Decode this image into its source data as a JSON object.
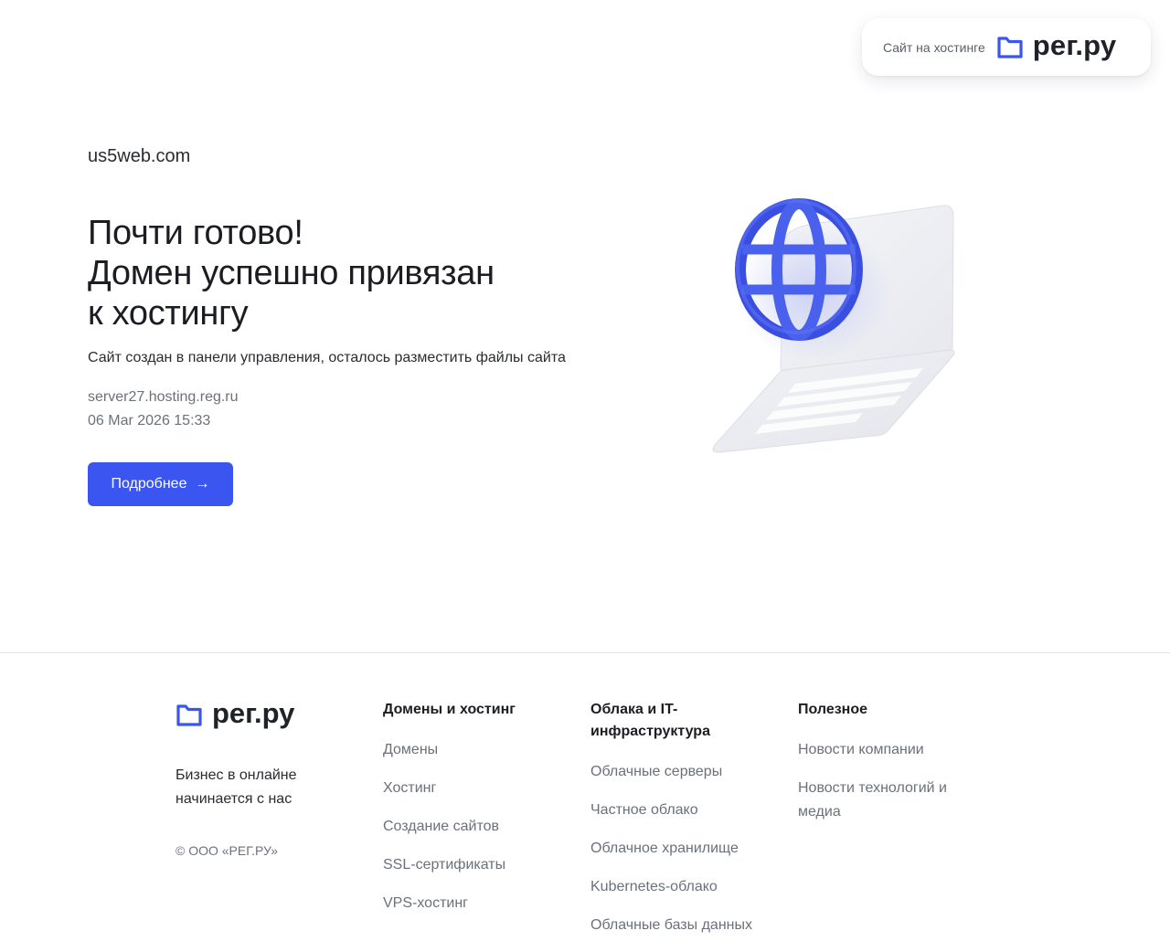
{
  "badge": {
    "label": "Сайт на хостинге",
    "logo_text": "рег.ру"
  },
  "main": {
    "domain": "us5web.com",
    "headline_lines": [
      "Почти готово!",
      "Домен успешно привязан",
      "к хостингу"
    ],
    "subtitle": "Сайт создан в панели управления, осталось разместить файлы сайта",
    "server": "server27.hosting.reg.ru",
    "datetime": "06 Mar 2026 15:33",
    "button_label": "Подробнее"
  },
  "footer": {
    "logo_text": "рег.ру",
    "tagline_lines": [
      "Бизнес в онлайне",
      "начинается с нас"
    ],
    "copyright": "© ООО «РЕГ.РУ»",
    "columns": [
      {
        "title": "Домены и хостинг",
        "items": [
          "Домены",
          "Хостинг",
          "Создание сайтов",
          "SSL-сертификаты",
          "VPS-хостинг"
        ]
      },
      {
        "title": "Облака и IT-инфраструктура",
        "items": [
          "Облачные серверы",
          "Частное облако",
          "Облачное хранилище",
          "Kubernetes-облако",
          "Облачные базы данных"
        ]
      },
      {
        "title": "Полезное",
        "items": [
          "Новости компании",
          "Новости технологий и медиа"
        ]
      }
    ]
  },
  "colors": {
    "accent": "#3a55f0",
    "text": "#1b1d22",
    "muted": "#6b707a"
  },
  "icons": {
    "logo": "folder-logo-icon",
    "arrow": "arrow-right-icon",
    "illustration": "globe-laptop-illustration"
  }
}
